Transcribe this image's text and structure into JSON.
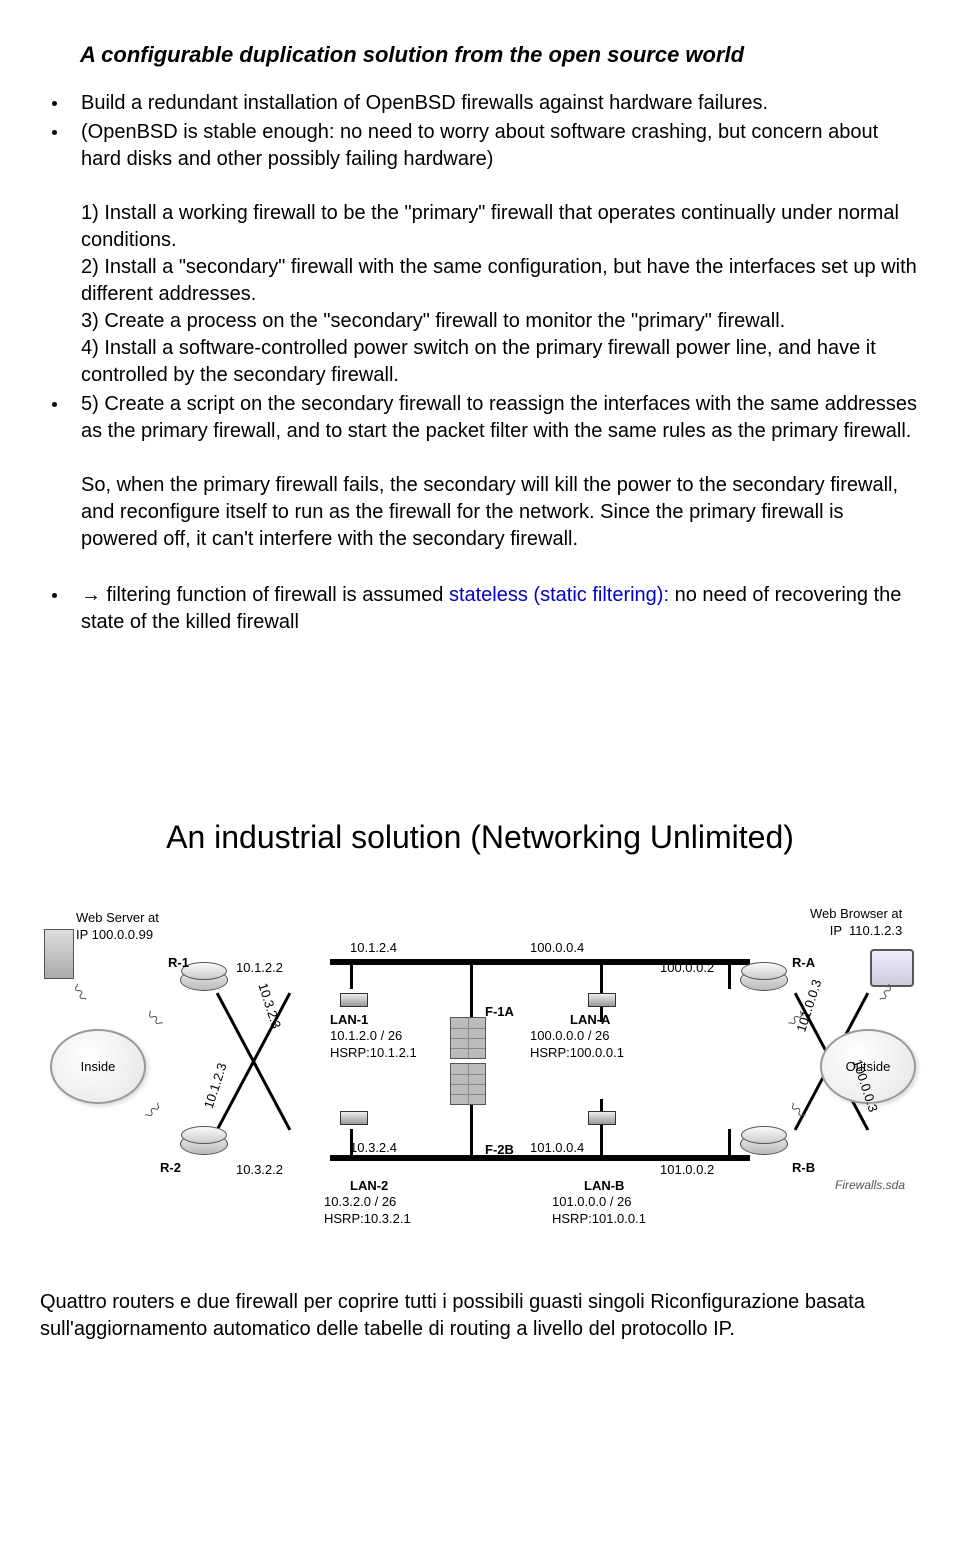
{
  "section1": {
    "title": "A configurable duplication solution from the open source world",
    "bullet1": "Build a redundant installation of OpenBSD firewalls against hardware failures.",
    "bullet2_lead": "(OpenBSD is stable enough: no need to worry about software crashing, but concern about hard disks and other possibly failing hardware)",
    "p1": "1) Install a working firewall to be the \"primary\" firewall that operates continually under normal conditions.",
    "p2": "2) Install a \"secondary\" firewall with the same configuration, but have the interfaces set up with different addresses.",
    "p3": "3) Create a process on the \"secondary\" firewall to monitor the \"primary\" firewall.",
    "p4": "4) Install a software-controlled power switch on the primary firewall power line, and have it controlled by the secondary firewall.",
    "bullet3": "5) Create a script on the secondary firewall to reassign the interfaces with the same addresses as the primary firewall, and to start the packet filter with the same rules as the primary firewall.",
    "para_so": "So, when the primary firewall fails, the secondary will kill the power to the secondary firewall, and reconfigure itself to run as the firewall for the network. Since the primary firewall is powered off, it can't interfere with the secondary firewall.",
    "bullet4_a": "→ filtering function of firewall is assumed ",
    "bullet4_blue": "stateless (static filtering):",
    "bullet4_b": " no need of recovering the state of the killed firewall"
  },
  "section2": {
    "title": "An industrial solution (Networking Unlimited)",
    "labels": {
      "webserver": "Web Server at\nIP 100.0.0.99",
      "inside": "Inside",
      "outside": "Outside",
      "webbrowser": "Web Browser at\nIP  110.1.2.3",
      "r1": "R-1",
      "r2": "R-2",
      "ra": "R-A",
      "rb": "R-B",
      "ip_1012_2": "10.1.2.2",
      "ip_1012_4": "10.1.2.4",
      "ip_10323": "10.3.2.3",
      "ip_10123": "10.1.2.3",
      "ip_1032_2": "10.3.2.2",
      "ip_1032_4": "10.3.2.4",
      "ip_100004": "100.0.0.4",
      "ip_100002": "100.0.0.2",
      "ip_101004": "101.0.0.4",
      "ip_101002": "101.0.0.2",
      "ip_101003": "101.0.0.3",
      "ip_100003": "100.0.0.3",
      "f1a": "F-1A",
      "f2b": "F-2B",
      "lan1": "LAN-1",
      "lan1_sub": "10.1.2.0 / 26\nHSRP:10.1.2.1",
      "lan2": "LAN-2",
      "lan2_sub": "10.3.2.0 / 26\nHSRP:10.3.2.1",
      "lana": "LAN-A",
      "lana_sub": "100.0.0.0 / 26\nHSRP:100.0.0.1",
      "lanb": "LAN-B",
      "lanb_sub": "101.0.0.0 / 26\nHSRP:101.0.0.1",
      "fwfile": "Firewalls.sda"
    },
    "final_para": "Quattro routers e due firewall per coprire tutti i possibili guasti singoli Riconfigurazione basata sull'aggiornamento automatico delle tabelle di routing a livello del protocollo IP."
  }
}
